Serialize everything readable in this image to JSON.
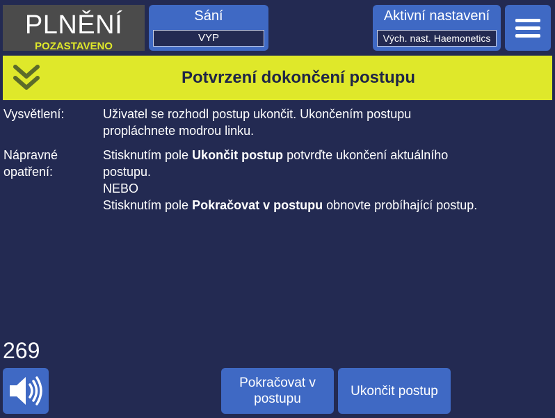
{
  "status": {
    "title": "PLNĚNÍ",
    "subtitle": "POZASTAVENO"
  },
  "suction": {
    "label": "Sání",
    "value": "VYP"
  },
  "active_settings": {
    "label": "Aktivní nastavení",
    "value": "Vých. nast. Haemonetics"
  },
  "menu": {
    "icon": "hamburger-menu-icon"
  },
  "banner": {
    "icon": "double-chevron-down-icon",
    "title": "Potvrzení dokončení postupu"
  },
  "explanation": {
    "label": "Vysvětlení:",
    "line1": "Uživatel se rozhodl postup ukončit. Ukončením postupu",
    "line2": "propláchnete modrou linku."
  },
  "remedy": {
    "label_line1": "Nápravné",
    "label_line2": "opatření:",
    "line1_prefix": "Stisknutím pole ",
    "line1_bold": "Ukončit postup",
    "line1_suffix": " potvrďte ukončení aktuálního",
    "line2": "postupu.",
    "line3": "NEBO",
    "line4_prefix": "Stisknutím pole ",
    "line4_bold": "Pokračovat v postupu",
    "line4_suffix": " obnovte probíhající postup."
  },
  "counter": "269",
  "sound": {
    "icon": "speaker-icon"
  },
  "buttons": {
    "continue_line1": "Pokračovat v",
    "continue_line2": "postupu",
    "end": "Ukončit postup"
  },
  "colors": {
    "background": "#232a52",
    "panel": "#3f69c4",
    "banner": "#dfe82a",
    "status_box": "#4b4b4b",
    "status_sub": "#dfe82a",
    "banner_text": "#1f2547"
  }
}
